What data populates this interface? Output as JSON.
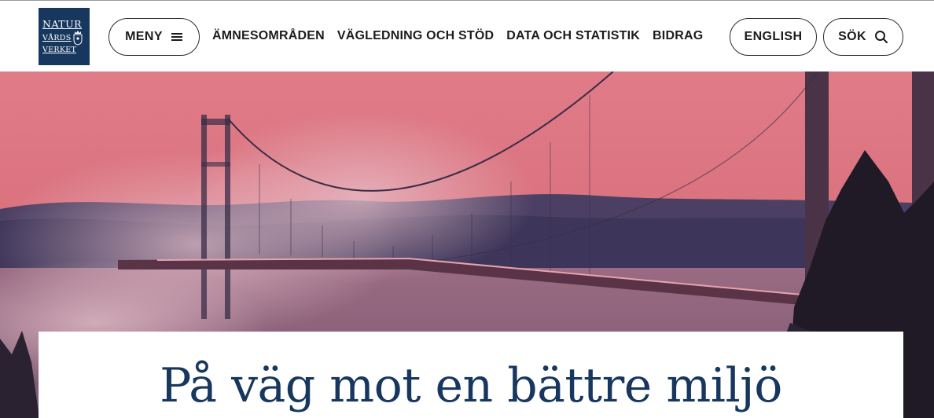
{
  "logo": {
    "line1": "NATUR",
    "line2": "VÅRDS",
    "line3": "VERKET",
    "icon": "crest-icon"
  },
  "header": {
    "menu_label": "MENY",
    "menu_icon": "hamburger-icon",
    "nav_items": [
      {
        "label": "ÄMNESOMRÅDEN"
      },
      {
        "label": "VÄGLEDNING OCH STÖD"
      },
      {
        "label": "DATA OCH STATISTIK"
      },
      {
        "label": "BIDRAG"
      }
    ],
    "english_label": "ENGLISH",
    "search_label": "SÖK",
    "search_icon": "search-icon"
  },
  "hero": {
    "image": "suspension-bridge-misty-pink-sky",
    "title": "På väg mot en bättre miljö"
  },
  "colors": {
    "brand_navy": "#17375e",
    "sky_pink": "#e0767f",
    "text_dark": "#1c1c1c"
  }
}
